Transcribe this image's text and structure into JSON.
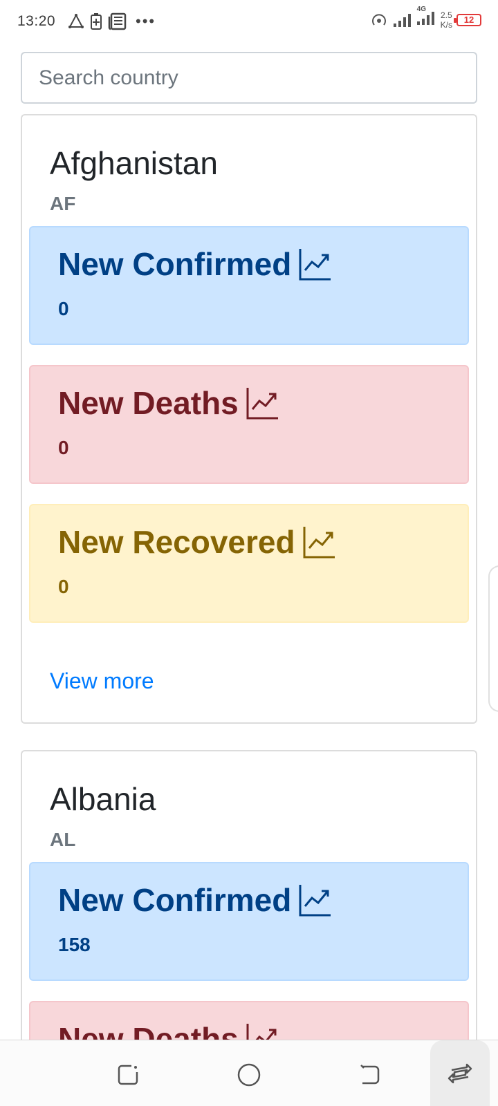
{
  "status_bar": {
    "time": "13:20",
    "network_type": "4G",
    "speed_value": "2.5",
    "speed_unit": "K/s",
    "battery": "12",
    "more_dots": "•••"
  },
  "search": {
    "placeholder": "Search country"
  },
  "countries": [
    {
      "name": "Afghanistan",
      "code": "AF",
      "stats": [
        {
          "label": "New Confirmed",
          "value": "0"
        },
        {
          "label": "New Deaths",
          "value": "0"
        },
        {
          "label": "New Recovered",
          "value": "0"
        }
      ],
      "view_more": "View more"
    },
    {
      "name": "Albania",
      "code": "AL",
      "stats": [
        {
          "label": "New Confirmed",
          "value": "158"
        },
        {
          "label": "New Deaths",
          "value": ""
        }
      ]
    }
  ],
  "colors": {
    "confirmed_bg": "#cce5ff",
    "confirmed_text": "#004085",
    "deaths_bg": "#f8d7da",
    "deaths_text": "#721c24",
    "recovered_bg": "#fff3cd",
    "recovered_text": "#856404",
    "link": "#007bff"
  }
}
